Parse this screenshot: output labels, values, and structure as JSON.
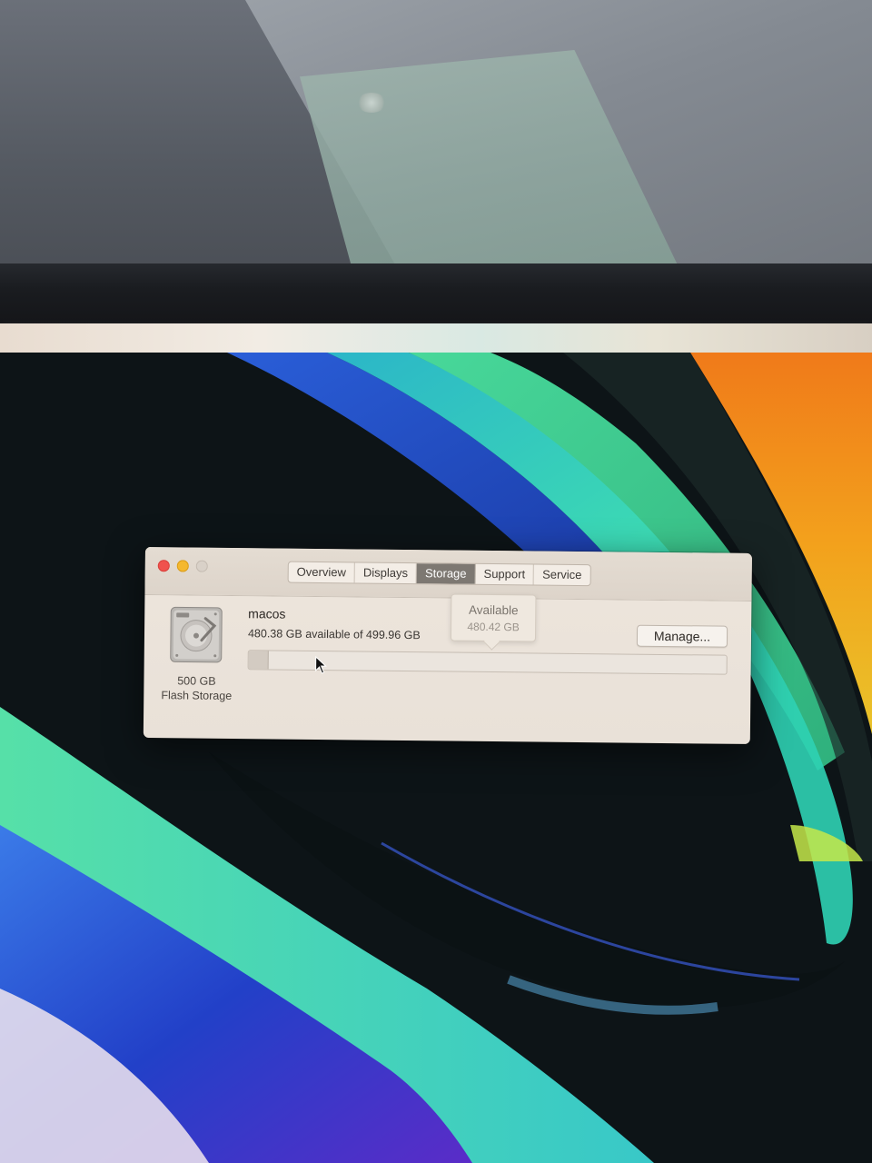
{
  "window": {
    "tabs": [
      {
        "label": "Overview"
      },
      {
        "label": "Displays"
      },
      {
        "label": "Storage"
      },
      {
        "label": "Support"
      },
      {
        "label": "Service"
      }
    ],
    "active_tab": "Storage"
  },
  "disk": {
    "icon": "hard-drive-icon",
    "capacity": "500 GB",
    "type": "Flash Storage"
  },
  "volume": {
    "name": "macos",
    "available_text": "480.38 GB available of 499.96 GB",
    "used_fraction": 0.0392,
    "manage_label": "Manage..."
  },
  "tooltip": {
    "title": "Available",
    "value": "480.42 GB"
  },
  "colors": {
    "close": "#f0524d",
    "minimize": "#f5b82e",
    "active_tab": "#7d7872"
  }
}
